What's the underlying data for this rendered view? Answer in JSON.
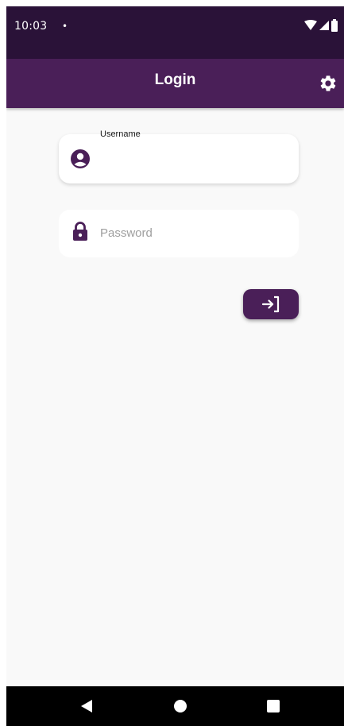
{
  "status_bar": {
    "time": "10:03",
    "dot": "•"
  },
  "app_bar": {
    "title": "Login",
    "settings_icon": "gear-icon"
  },
  "form": {
    "username": {
      "label": "Username",
      "value": "",
      "icon": "account-circle-icon"
    },
    "password": {
      "placeholder": "Password",
      "value": "",
      "icon": "lock-icon"
    },
    "submit_icon": "login-arrow-icon"
  },
  "nav_bar": {
    "back_icon": "back-triangle-icon",
    "home_icon": "home-circle-icon",
    "recents_icon": "recents-square-icon"
  },
  "colors": {
    "status_bar": "#2a1238",
    "app_bar": "#4a1f58",
    "accent": "#4a1f58",
    "background": "#f9f9f9",
    "nav_bar": "#000000"
  }
}
